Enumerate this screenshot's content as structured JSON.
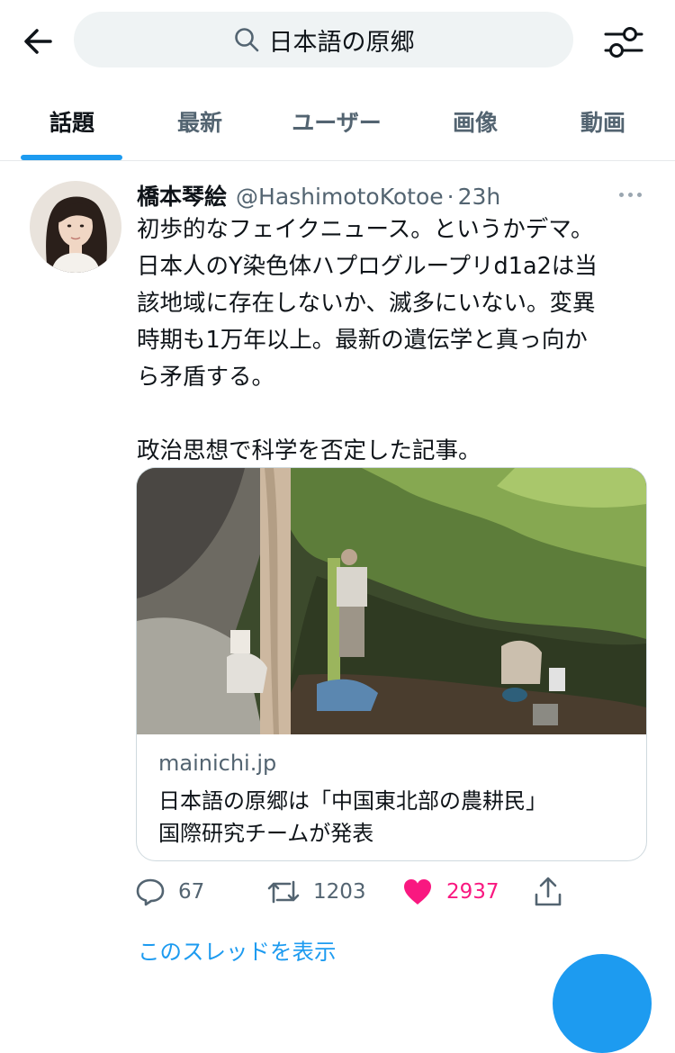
{
  "search": {
    "query": "日本語の原郷"
  },
  "tabs": [
    {
      "label": "話題",
      "active": true
    },
    {
      "label": "最新"
    },
    {
      "label": "ユーザー"
    },
    {
      "label": "画像"
    },
    {
      "label": "動画"
    }
  ],
  "tweet": {
    "author_name": "橋本琴絵",
    "handle": "@HashimotoKotoe",
    "separator": "·",
    "time": "23h",
    "lines": [
      "初歩的なフェイクニュース。というかデマ。",
      "日本人のY染色体ハプログループリd1a2は当",
      "該地域に存在しないか、滅多にいない。変異",
      "時期も1万年以上。最新の遺伝学と真っ向か",
      "ら矛盾する。"
    ],
    "line_after": "政治思想で科学を否定した記事。",
    "card": {
      "domain": "mainichi.jp",
      "title_line1": "日本語の原郷は「中国東北部の農耕民」",
      "title_line2": "国際研究チームが発表"
    },
    "stats": {
      "replies": "67",
      "retweets": "1203",
      "likes": "2937"
    },
    "show_thread": "このスレッドを表示"
  },
  "colors": {
    "accent": "#1d9bf0",
    "like": "#f91880",
    "muted": "#536471",
    "text": "#0f1419"
  },
  "icons": [
    "back-arrow-icon",
    "search-icon",
    "filter-sliders-icon",
    "more-dots-icon",
    "reply-icon",
    "retweet-icon",
    "heart-icon",
    "share-icon"
  ]
}
